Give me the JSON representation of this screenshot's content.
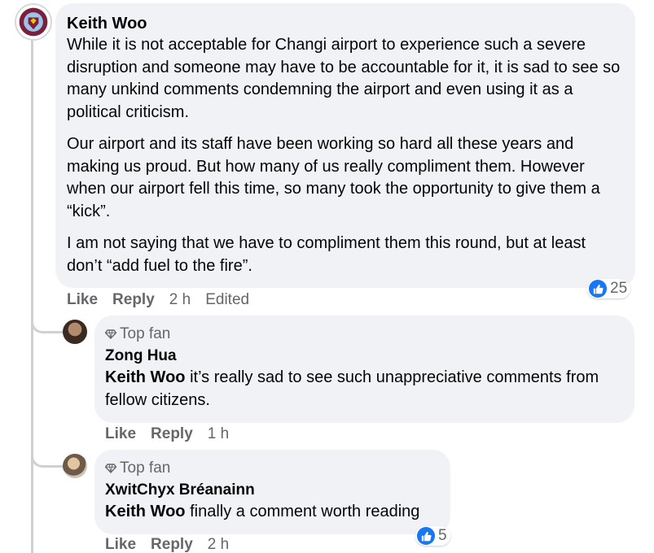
{
  "main_comment": {
    "author": "Keith Woo",
    "paragraphs": [
      "While it is not acceptable for Changi airport to experience such a severe disruption and someone may have to be accountable for it, it is sad to see so many unkind comments condemning the airport and even using it as a political criticism.",
      "Our airport and its staff have been working so hard all these years and making us proud. But how many of us really compliment them. However when our airport fell this time, so many took the opportunity to give them a “kick”.",
      "I am not saying that we have to compliment them this round, but at least don’t “add fuel to the fire”."
    ],
    "like_label": "Like",
    "reply_label": "Reply",
    "time": "2 h",
    "edited": "Edited",
    "reaction_count": "25",
    "reaction_icon": "like-icon"
  },
  "replies": [
    {
      "badge": "Top fan",
      "author": "Zong Hua",
      "mention": "Keith Woo",
      "text": " it’s really sad to see such unappreciative comments from fellow citizens.",
      "like_label": "Like",
      "reply_label": "Reply",
      "time": "1 h"
    },
    {
      "badge": "Top fan",
      "author": "XwitChyx Bréanainn",
      "mention": "Keith Woo",
      "text": " finally a comment worth reading",
      "like_label": "Like",
      "reply_label": "Reply",
      "time": "2 h",
      "reaction_count": "5",
      "reaction_icon": "like-icon"
    }
  ],
  "colors": {
    "bubble": "#f0f2f5",
    "secondary_text": "#65676b",
    "like_blue": "#1877f2",
    "thread_line": "#ced0d4"
  }
}
